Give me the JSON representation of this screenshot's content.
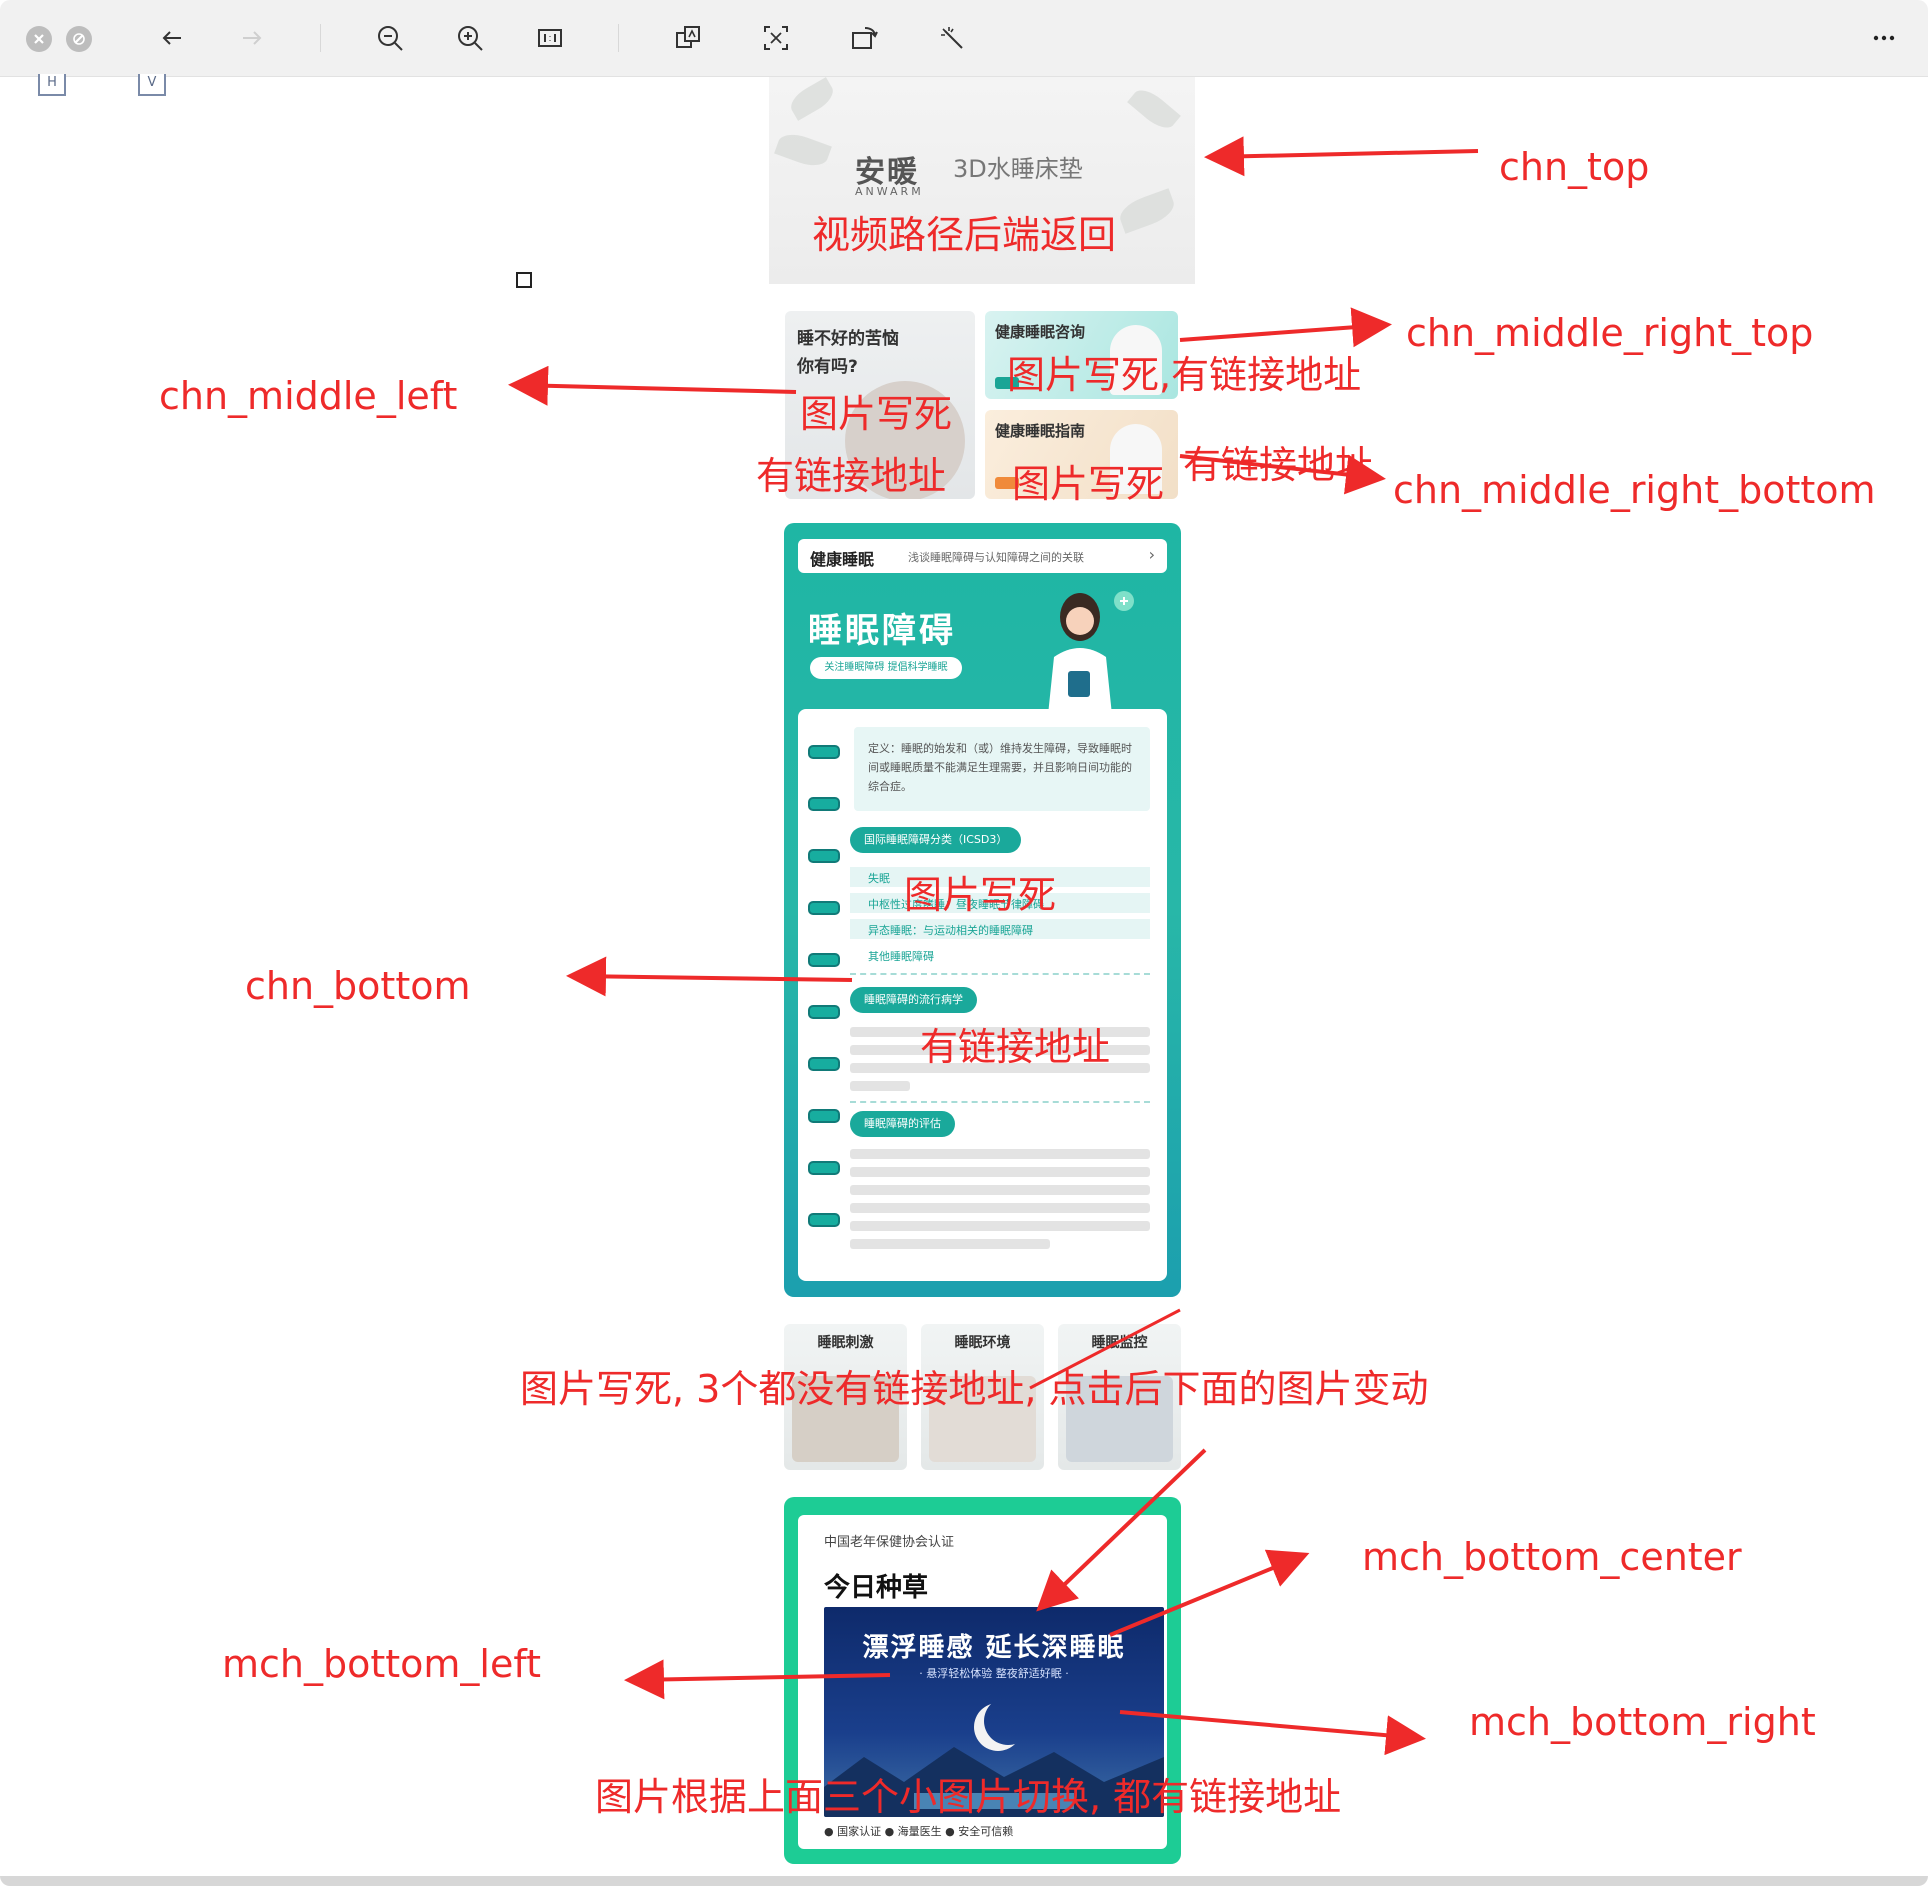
{
  "toolbar": {
    "close_icon": "close-icon",
    "minimize_icon": "minimize-icon",
    "back_icon": "arrow-left-icon",
    "forward_icon": "arrow-right-icon",
    "zoom_out_icon": "zoom-out-icon",
    "zoom_in_icon": "zoom-in-icon",
    "actual_size_icon": "actual-size-icon",
    "translate_icon": "translate-icon",
    "ocr_icon": "text-recognize-icon",
    "rotate_icon": "rotate-icon",
    "magic_icon": "magic-wand-icon",
    "more_icon": "more-icon"
  },
  "canvas": {
    "left_boxes": [
      "H",
      "V"
    ]
  },
  "mock": {
    "top_brand": "安暖",
    "top_brand_sub": "3D水睡床垫",
    "top_brand_en": "ANWARM",
    "mid_left_title_line1": "睡不好的苦恼",
    "mid_left_title_line2": "你有吗?",
    "mid_rt_title": "健康睡眠咨询",
    "mid_rb_title": "健康睡眠指南",
    "card_brand": "健康睡眠",
    "card_sub": "浅谈睡眠障碍与认知障碍之间的关联",
    "card_title": "睡眠障碍",
    "card_pill": "关注睡眠障碍 提倡科学睡眠",
    "card_def": "定义：睡眠的始发和（或）维持发生障碍，导致睡眠时间或睡眠质量不能满足生理需要，并且影响日间功能的综合症。",
    "card_sec1": "国际睡眠障碍分类（ICSD3）",
    "card_row1": "失眠",
    "card_row2": "中枢性过度嗜睡：昼夜睡眠节律障碍",
    "card_row3": "异态睡眠：与运动相关的睡眠障碍",
    "card_row4": "其他睡眠障碍",
    "card_sec2": "睡眠障碍的流行病学",
    "card_sec3": "睡眠障碍的评估",
    "thumb1": "睡眠刺激",
    "thumb2": "睡眠环境",
    "thumb3": "睡眠监控",
    "mch_assoc": "中国老年保健协会认证",
    "mch_logo": "今日种草",
    "mch_banner_title": "漂浮睡感 延长深睡眠",
    "mch_banner_sub": "· 悬浮轻松体验 整夜舒适好眠 ·",
    "mch_foot": "● 国家认证   ● 海量医生   ● 安全可信赖"
  },
  "annotations": {
    "chn_top": "chn_top",
    "chn_top_note": "视频路径后端返回",
    "chn_middle_right_top": "chn_middle_right_top",
    "chn_middle_right_top_note": "图片写死,有链接地址",
    "chn_middle_left": "chn_middle_left",
    "chn_middle_left_note1": "图片写死",
    "chn_middle_left_note2": "有链接地址",
    "chn_middle_right_bottom": "chn_middle_right_bottom",
    "chn_middle_right_bottom_note1": "有链接地址",
    "chn_middle_right_bottom_note2": "图片写死",
    "chn_bottom": "chn_bottom",
    "chn_bottom_note1": "图片写死",
    "chn_bottom_note2": "有链接地址",
    "thumbs_note": "图片写死, 3个都没有链接地址, 点击后下面的图片变动",
    "mch_bottom_center": "mch_bottom_center",
    "mch_bottom_left": "mch_bottom_left",
    "mch_bottom_right": "mch_bottom_right",
    "mch_note": "图片根据上面三个小图片切换, 都有链接地址"
  },
  "colors": {
    "annotation": "#ee2a2a",
    "teal": "#1fb6a4",
    "green": "#1dcc95"
  }
}
